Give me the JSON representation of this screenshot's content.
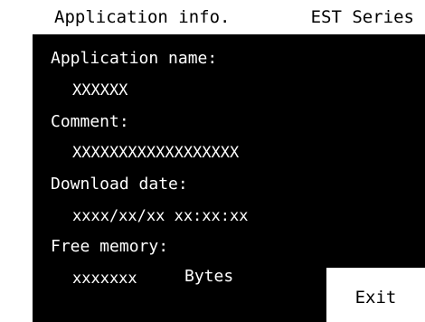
{
  "header": {
    "title": "Application info.",
    "series": "EST Series"
  },
  "info": {
    "application_name_label": "Application name:",
    "application_name_value": "XXXXXX",
    "comment_label": "Comment:",
    "comment_value": "XXXXXXXXXXXXXXXXXX",
    "download_date_label": "Download date:",
    "download_date_value": "xxxx/xx/xx xx:xx:xx",
    "free_memory_label": "Free memory:",
    "free_memory_value": "xxxxxxx",
    "free_memory_unit": "Bytes"
  },
  "actions": {
    "exit_label": "Exit"
  },
  "colors": {
    "panel_background": "#000000",
    "panel_text": "#ffffff",
    "header_background": "#ffffff",
    "button_background": "#ffffff"
  }
}
